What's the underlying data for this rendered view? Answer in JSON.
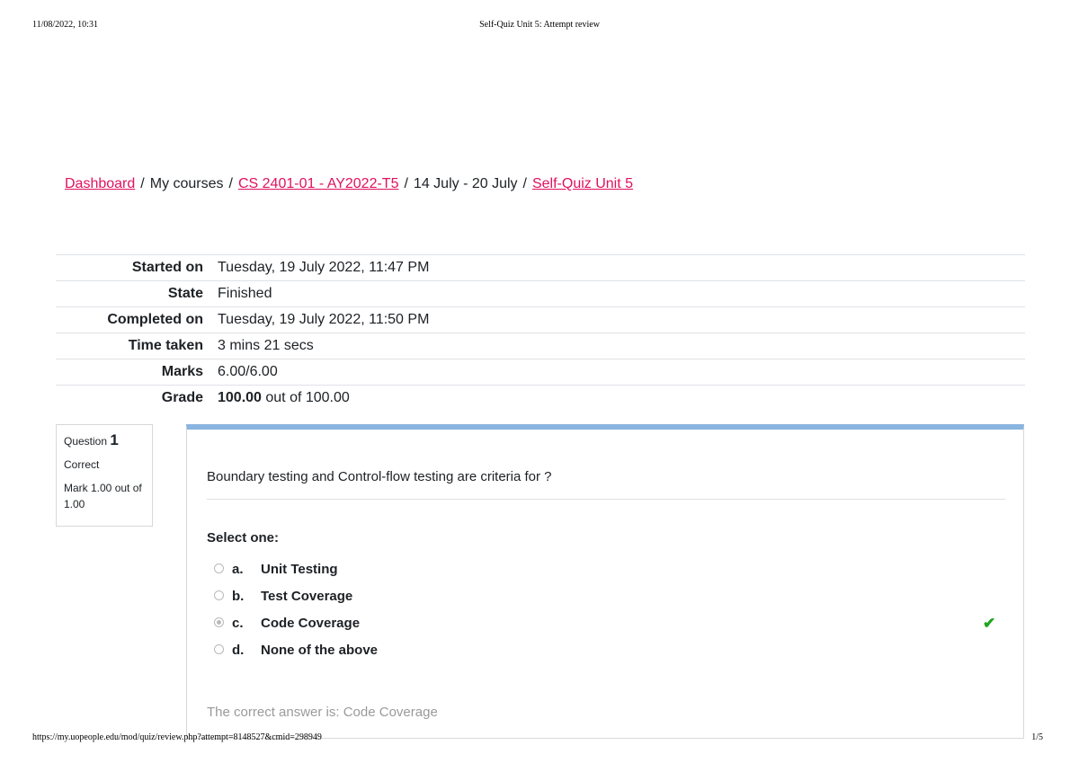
{
  "print_header": {
    "datetime": "11/08/2022, 10:31",
    "title": "Self-Quiz Unit 5: Attempt review"
  },
  "print_footer": {
    "url": "https://my.uopeople.edu/mod/quiz/review.php?attempt=8148527&cmid=298949",
    "page": "1/5"
  },
  "breadcrumb": {
    "items": [
      {
        "label": "Dashboard",
        "link": true
      },
      {
        "label": "My courses",
        "link": false
      },
      {
        "label": "CS 2401-01 - AY2022-T5",
        "link": true
      },
      {
        "label": "14 July - 20 July",
        "link": false
      },
      {
        "label": "Self-Quiz Unit 5",
        "link": true
      }
    ],
    "separator": "/"
  },
  "summary": {
    "rows": [
      {
        "label": "Started on",
        "value": "Tuesday, 19 July 2022, 11:47 PM"
      },
      {
        "label": "State",
        "value": "Finished"
      },
      {
        "label": "Completed on",
        "value": "Tuesday, 19 July 2022, 11:50 PM"
      },
      {
        "label": "Time taken",
        "value": "3 mins 21 secs"
      },
      {
        "label": "Marks",
        "value": "6.00/6.00"
      },
      {
        "label": "Grade",
        "value_strong": "100.00",
        "value_rest": " out of 100.00"
      }
    ]
  },
  "question": {
    "label": "Question",
    "number": "1",
    "status": "Correct",
    "mark": "Mark 1.00 out of 1.00",
    "text": "Boundary testing and Control-flow testing are criteria for ?",
    "prompt": "Select one:",
    "answers": [
      {
        "letter": "a.",
        "text": "Unit Testing",
        "selected": false
      },
      {
        "letter": "b.",
        "text": "Test Coverage",
        "selected": false
      },
      {
        "letter": "c.",
        "text": "Code Coverage",
        "selected": true
      },
      {
        "letter": "d.",
        "text": "None of the above",
        "selected": false
      }
    ],
    "correct_icon": "check-icon",
    "feedback": "The correct answer is: Code Coverage",
    "colors": {
      "accent_bar": "#8ab4e0",
      "correct": "#1fa51f",
      "link": "#e0115f"
    }
  }
}
